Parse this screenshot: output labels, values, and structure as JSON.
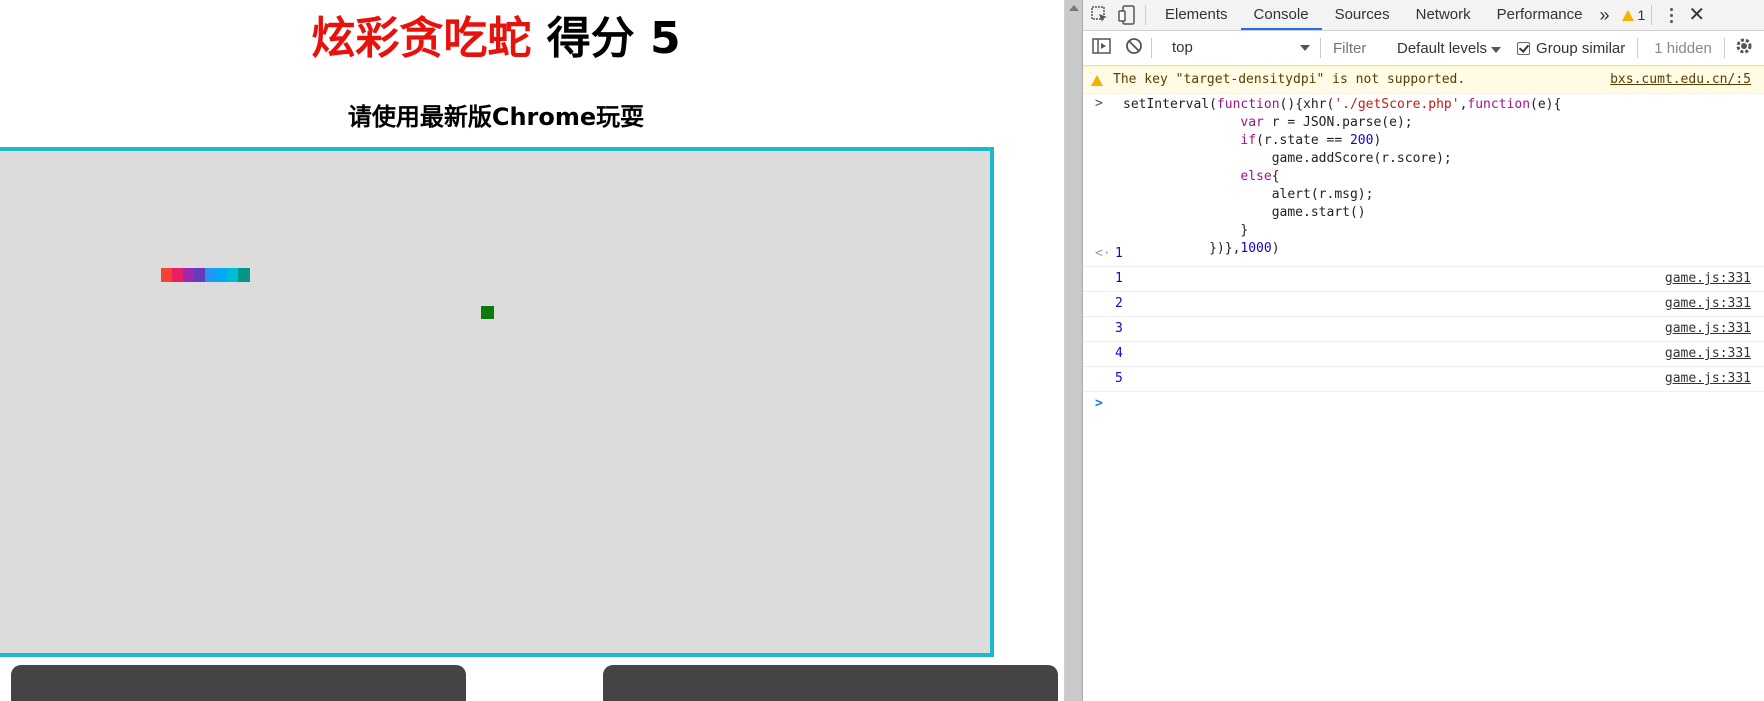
{
  "game": {
    "title": "炫彩贪吃蛇",
    "score_label": "得分",
    "score_value": "5",
    "subtitle": "请使用最新版Chrome玩耍",
    "snake_colors": [
      "#f44336",
      "#e91e63",
      "#9c27b0",
      "#673ab7",
      "#2196f3",
      "#03a9f4",
      "#00bcd4",
      "#009688"
    ],
    "food_color": "#0a7a0a",
    "board_color": "#dcdcdc",
    "border_color": "#1eb8cc"
  },
  "devtools": {
    "tabs": [
      "Elements",
      "Console",
      "Sources",
      "Network",
      "Performance"
    ],
    "active_tab": "Console",
    "more_tabs": "»",
    "warning_count": "1",
    "close": "✕",
    "toolbar": {
      "context": "top",
      "filter_placeholder": "Filter",
      "levels": "Default levels",
      "group_similar": "Group similar",
      "hidden": "1 hidden"
    },
    "warning": {
      "message": "The key \"target-densitydpi\" is not supported.",
      "source": "bxs.cumt.edu.cn/:5"
    },
    "result_value": "1",
    "logs": [
      {
        "value": "1",
        "source": "game.js:331"
      },
      {
        "value": "2",
        "source": "game.js:331"
      },
      {
        "value": "3",
        "source": "game.js:331"
      },
      {
        "value": "4",
        "source": "game.js:331"
      },
      {
        "value": "5",
        "source": "game.js:331"
      }
    ]
  }
}
